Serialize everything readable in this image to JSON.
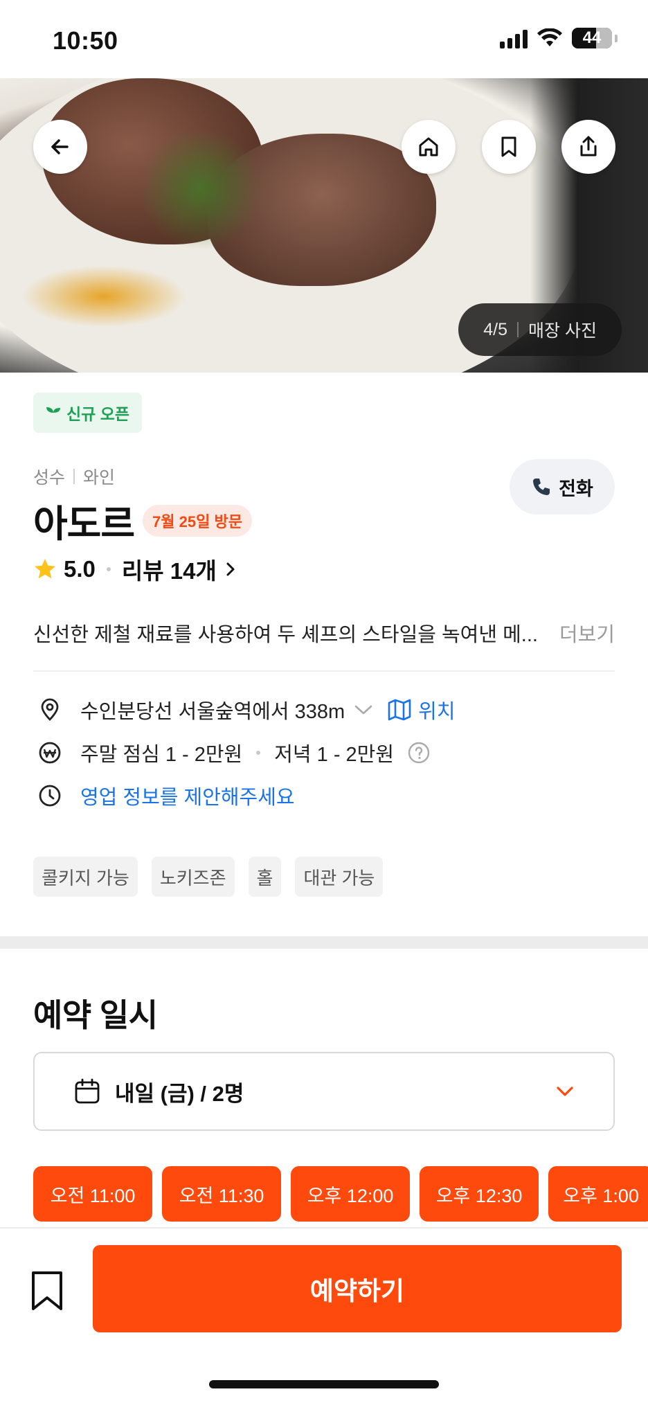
{
  "status_bar": {
    "time": "10:50",
    "battery": "44"
  },
  "hero": {
    "photo_index": "4/5",
    "photo_label": "매장 사진",
    "icons": [
      "back-arrow-icon",
      "home-icon",
      "bookmark-icon",
      "share-icon"
    ]
  },
  "badge_new": "신규 오픈",
  "breadcrumb": {
    "area": "성수",
    "category": "와인"
  },
  "call_label": "전화",
  "restaurant": {
    "name": "아도르",
    "visit_badge": "7월 25일 방문",
    "rating": "5.0",
    "reviews": "리뷰 14개",
    "description": "신선한 제철 재료를 사용하여 두 셰프의 스타일을 녹여낸 메...",
    "more": "더보기"
  },
  "info": {
    "location": "수인분당선 서울숲역에서 338m",
    "location_link": "위치",
    "price_lunch": "주말 점심 1 - 2만원",
    "price_dinner": "저녁 1 - 2만원",
    "hours_link": "영업 정보를 제안해주세요"
  },
  "tags": [
    "콜키지 가능",
    "노키즈존",
    "홀",
    "대관 가능"
  ],
  "reservation": {
    "title": "예약 일시",
    "date_value": "내일 (금) / 2명",
    "slots": [
      "오전 11:00",
      "오전 11:30",
      "오후 12:00",
      "오후 12:30",
      "오후 1:00"
    ]
  },
  "bottom": {
    "reserve_label": "예약하기"
  },
  "colors": {
    "accent": "#ff4a0e",
    "link": "#1a73e8",
    "new_green": "#1f9f55",
    "star": "#ffc21a"
  }
}
